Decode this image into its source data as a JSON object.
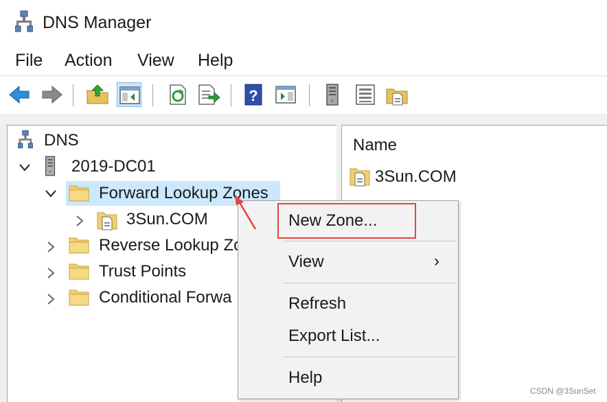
{
  "window": {
    "title": "DNS Manager"
  },
  "menubar": {
    "items": [
      "File",
      "Action",
      "View",
      "Help"
    ]
  },
  "toolbar": {
    "buttons": [
      "back-arrow-icon",
      "forward-arrow-icon",
      "up-folder-icon",
      "show-hide-tree-icon",
      "refresh-icon",
      "export-list-icon",
      "help-icon",
      "action-pane-icon",
      "server-icon",
      "list-icon",
      "zone-icon"
    ]
  },
  "tree": {
    "root": "DNS",
    "server": "2019-DC01",
    "forward_zones": "Forward Lookup Zones",
    "forward_child": "3Sun.COM",
    "reverse_zones": "Reverse Lookup Zo",
    "trust_points": "Trust Points",
    "conditional_forwarders": "Conditional Forwa"
  },
  "results": {
    "column_name": "Name",
    "rows": [
      "3Sun.COM"
    ]
  },
  "context_menu": {
    "new_zone": "New Zone...",
    "view": "View",
    "view_submenu_arrow": "›",
    "refresh": "Refresh",
    "export_list": "Export List...",
    "help": "Help"
  },
  "annotation": {
    "highlight_color": "#e0453b"
  },
  "colors": {
    "selection": "#cce8ff",
    "accent_blue": "#2b7bd6"
  },
  "watermark": "CSDN @3SunSet"
}
